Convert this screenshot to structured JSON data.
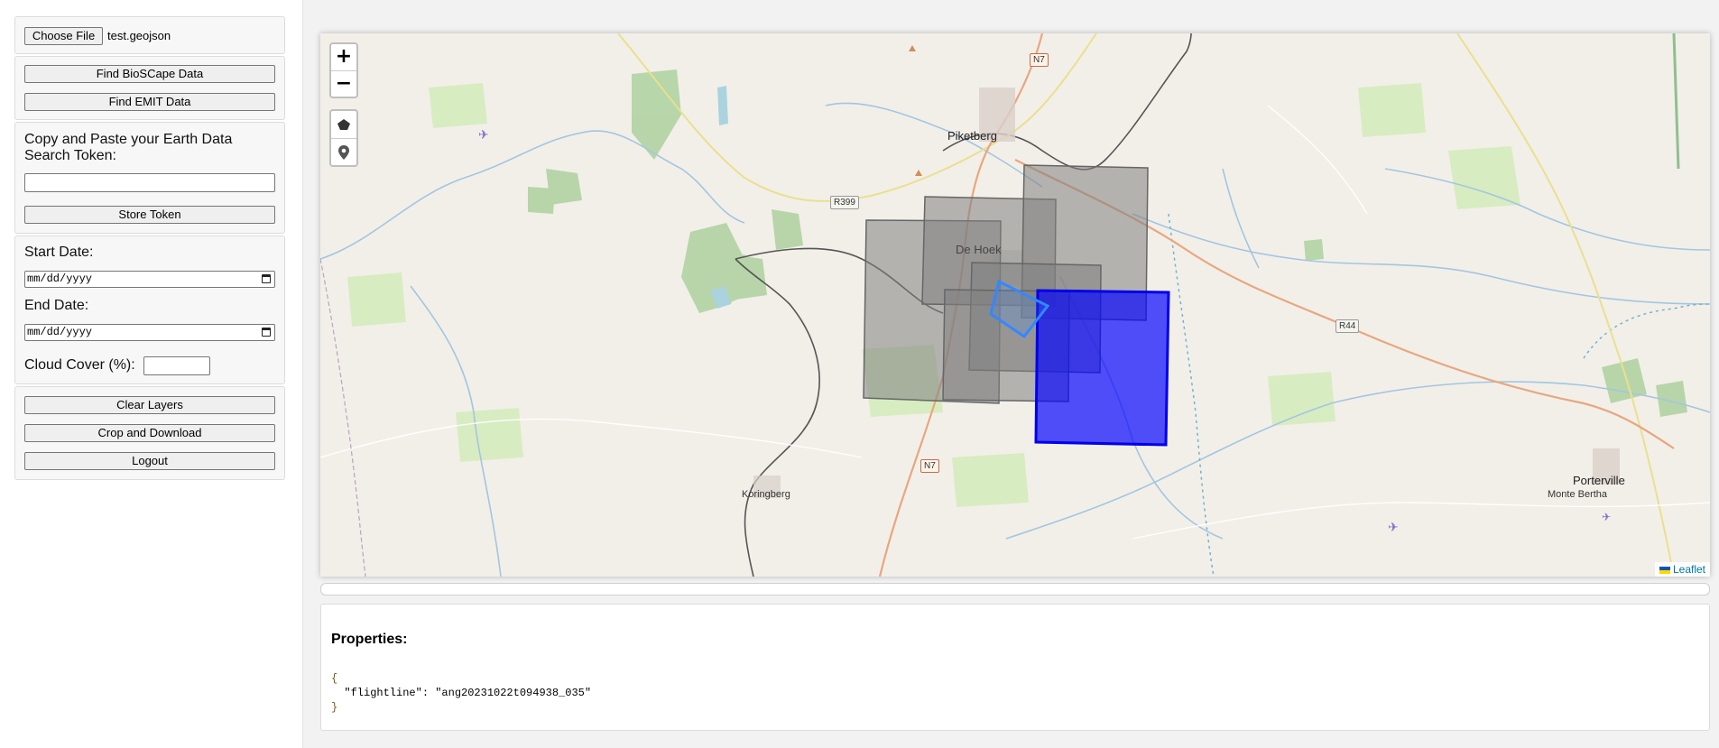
{
  "sidebar": {
    "file": {
      "button_label": "Choose File",
      "file_name": "test.geojson"
    },
    "find_bioscape_label": "Find BioSCape Data",
    "find_emit_label": "Find EMIT Data",
    "token": {
      "label": "Copy and Paste your Earth Data Search Token:",
      "value": "",
      "store_label": "Store Token"
    },
    "start_date": {
      "label": "Start Date:",
      "placeholder": "mm/dd/yyyy"
    },
    "end_date": {
      "label": "End Date:",
      "placeholder": "mm/dd/yyyy"
    },
    "cloud_cover": {
      "label": "Cloud Cover (%):",
      "value": ""
    },
    "clear_layers_label": "Clear Layers",
    "crop_download_label": "Crop and Download",
    "logout_label": "Logout"
  },
  "map": {
    "zoom_in": "+",
    "zoom_out": "−",
    "tools": [
      "polygon-icon",
      "marker-icon"
    ],
    "attribution": "Leaflet",
    "places": {
      "piketberg": "Piketberg",
      "de_hoek": "De Hoek",
      "koringberg": "Koringberg",
      "porterville": "Porterville",
      "monte_bertha": "Monte Bertha"
    },
    "roads": {
      "n7_top": "N7",
      "n7_bottom": "N7",
      "r399": "R399",
      "r44": "R44"
    },
    "colors": {
      "footprint_fill": "#888888",
      "selected_fill": "#0000ff",
      "highlight_outline": "#3388ff"
    }
  },
  "properties": {
    "title": "Properties:",
    "json_open": "{",
    "json_line": "  \"flightline\": \"ang20231022t094938_035\"",
    "json_close": "}"
  }
}
